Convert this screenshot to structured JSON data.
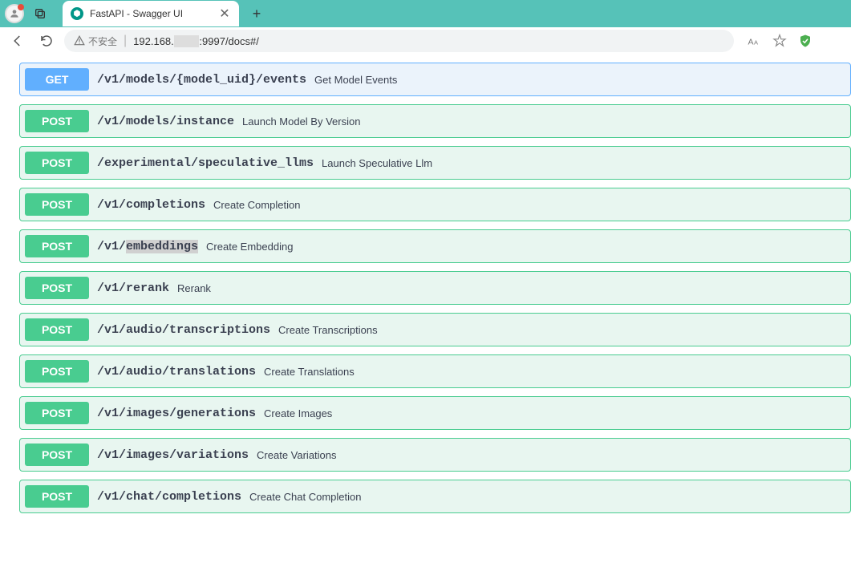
{
  "browser": {
    "tab_title": "FastAPI - Swagger UI",
    "url_prefix": "192.168.",
    "url_suffix": ":9997/docs#/",
    "insecure_label": "不安全"
  },
  "endpoints": [
    {
      "method": "GET",
      "path": "/v1/models/{model_uid}/events",
      "summary": "Get Model Events",
      "highlight": null
    },
    {
      "method": "POST",
      "path": "/v1/models/instance",
      "summary": "Launch Model By Version",
      "highlight": null
    },
    {
      "method": "POST",
      "path": "/experimental/speculative_llms",
      "summary": "Launch Speculative Llm",
      "highlight": null
    },
    {
      "method": "POST",
      "path": "/v1/completions",
      "summary": "Create Completion",
      "highlight": null
    },
    {
      "method": "POST",
      "path_pre": "/v1/",
      "path_hl": "embeddings",
      "summary": "Create Embedding",
      "highlight": "embeddings"
    },
    {
      "method": "POST",
      "path": "/v1/rerank",
      "summary": "Rerank",
      "highlight": null
    },
    {
      "method": "POST",
      "path": "/v1/audio/transcriptions",
      "summary": "Create Transcriptions",
      "highlight": null
    },
    {
      "method": "POST",
      "path": "/v1/audio/translations",
      "summary": "Create Translations",
      "highlight": null
    },
    {
      "method": "POST",
      "path": "/v1/images/generations",
      "summary": "Create Images",
      "highlight": null
    },
    {
      "method": "POST",
      "path": "/v1/images/variations",
      "summary": "Create Variations",
      "highlight": null
    },
    {
      "method": "POST",
      "path": "/v1/chat/completions",
      "summary": "Create Chat Completion",
      "highlight": null
    }
  ]
}
